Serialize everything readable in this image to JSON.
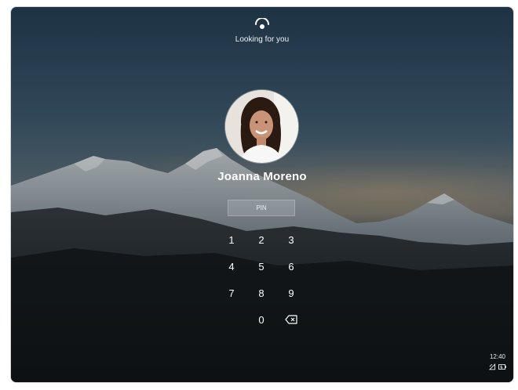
{
  "face_status": {
    "icon": "face-recognition-icon",
    "text": "Looking for you"
  },
  "user": {
    "name": "Joanna Moreno",
    "avatar_icon": "user-avatar"
  },
  "pin": {
    "placeholder": "PIN"
  },
  "keypad": {
    "keys": [
      "1",
      "2",
      "3",
      "4",
      "5",
      "6",
      "7",
      "8",
      "9",
      "0"
    ],
    "backspace_icon": "backspace-icon"
  },
  "taskbar": {
    "time": "12:40",
    "icons": [
      "network-icon",
      "battery-icon"
    ]
  },
  "colors": {
    "text": "#ffffff",
    "sky_top": "#223a4f",
    "ground": "#101315"
  }
}
